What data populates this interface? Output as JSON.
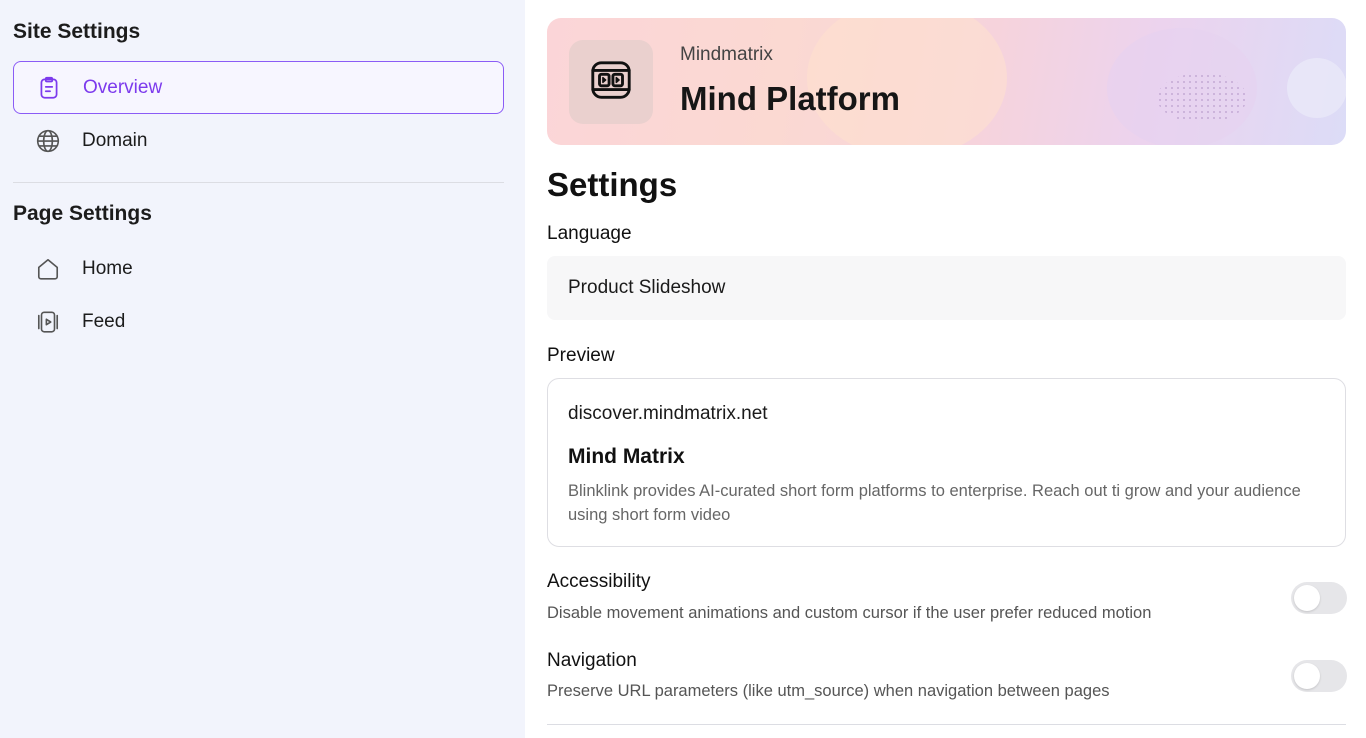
{
  "sidebar": {
    "site_heading": "Site Settings",
    "site_items": [
      {
        "label": "Overview",
        "icon": "clipboard-icon",
        "active": true
      },
      {
        "label": "Domain",
        "icon": "globe-icon",
        "active": false
      }
    ],
    "page_heading": "Page Settings",
    "page_items": [
      {
        "label": "Home",
        "icon": "home-icon"
      },
      {
        "label": "Feed",
        "icon": "video-feed-icon"
      }
    ]
  },
  "banner": {
    "org_name": "Mindmatrix",
    "platform_name": "Mind Platform",
    "logo_icon": "film-play-icon"
  },
  "settings": {
    "title": "Settings",
    "language": {
      "label": "Language",
      "value": "Product Slideshow"
    },
    "preview": {
      "label": "Preview",
      "url": "discover.mindmatrix.net",
      "title": "Mind Matrix",
      "description": "Blinklink provides AI-curated short form platforms to enterprise. Reach out ti grow and your audience using short form video"
    },
    "accessibility": {
      "label": "Accessibility",
      "description": "Disable movement animations and custom cursor if the user prefer reduced motion",
      "enabled": false
    },
    "navigation": {
      "label": "Navigation",
      "description": "Preserve URL parameters (like utm_source) when navigation between pages",
      "enabled": false
    }
  },
  "colors": {
    "accent": "#7c3aed",
    "sidebar_bg": "#f2f4fc",
    "toggle_off": "#e6e6e9"
  }
}
